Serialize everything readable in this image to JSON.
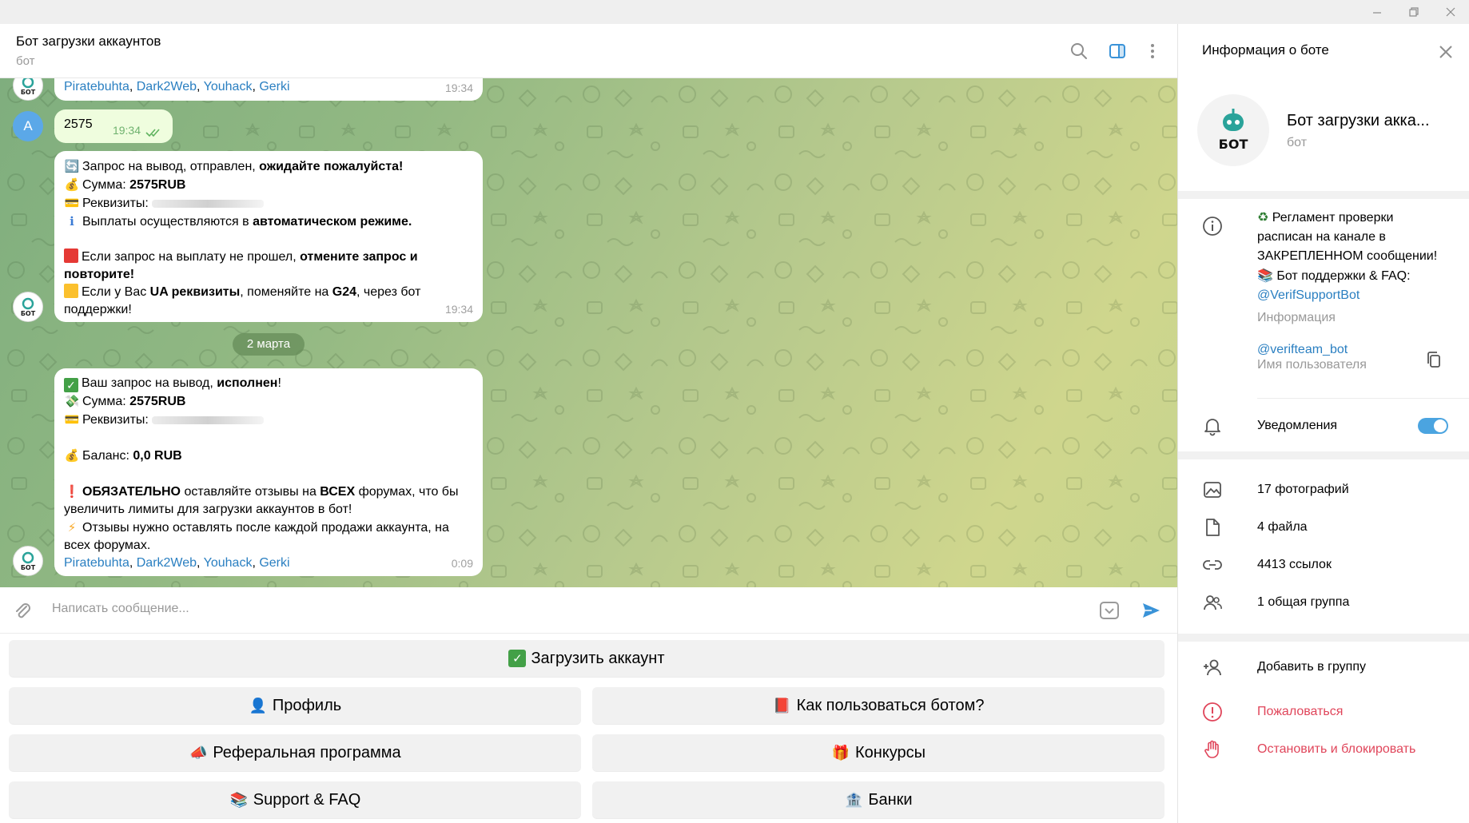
{
  "header": {
    "title": "Бот загрузки аккаунтов",
    "subtitle": "бот"
  },
  "messages": {
    "m1": {
      "links": [
        "Piratebuhta",
        "Dark2Web",
        "Youhack",
        "Gerki"
      ],
      "time": "19:34"
    },
    "m2": {
      "avatar_letter": "A",
      "text": "2575",
      "time": "19:34"
    },
    "m3": {
      "l1_pre": "Запрос на вывод,  отправлен, ",
      "l1_bold": "ожидайте пожалуйста!",
      "l2_pre": "Сумма: ",
      "l2_bold": "2575RUB",
      "l3_pre": "Реквизиты:",
      "l4_pre": "Выплаты осуществляются в ",
      "l4_bold": "автоматическом режиме.",
      "l5_pre": "Если запрос на выплату не прошел, ",
      "l5_bold": "отмените запрос и",
      "l6_bold": "повторите!",
      "l7_pre": "Если у Вас ",
      "l7_bold1": "UA реквизиты",
      "l7_mid": ", поменяйте на ",
      "l7_bold2": "G24",
      "l7_post": ", через бот",
      "l8": "поддержки!",
      "time": "19:34"
    },
    "date_divider": "2 марта",
    "m4": {
      "l1_pre": "Ваш запрос на вывод, ",
      "l1_bold": "исполнен",
      "l1_post": "!",
      "l2_pre": "Сумма: ",
      "l2_bold": "2575RUB",
      "l3_pre": "Реквизиты:",
      "l5_pre": "Баланс: ",
      "l5_bold": "0,0 RUB",
      "l6_bold1": "ОБЯЗАТЕЛЬНО",
      "l6_mid": " оставляйте отзывы на ",
      "l6_bold2": "ВСЕХ",
      "l6_post": " форумах, что бы",
      "l7": "увеличить лимиты для загрузки аккаунтов в бот!",
      "l8": "Отзывы нужно оставлять после каждой продажи аккаунта, на",
      "l9": "всех форумах.",
      "links": [
        "Piratebuhta",
        "Dark2Web",
        "Youhack",
        "Gerki"
      ],
      "time": "0:09"
    }
  },
  "input": {
    "placeholder": "Написать сообщение..."
  },
  "keyboard": {
    "upload": "Загрузить аккаунт",
    "profile": "Профиль",
    "howto": "Как пользоваться ботом?",
    "referral": "Реферальная программа",
    "contests": "Конкурсы",
    "support": "Support & FAQ",
    "banks": "Банки"
  },
  "panel": {
    "title": "Информация о боте",
    "name": "Бот загрузки акка...",
    "sub": "бот",
    "avatar_text": "БОТ",
    "info_l1": "Регламент проверки",
    "info_l2": "расписан на канале в",
    "info_l3": "ЗАКРЕПЛЕННОМ сообщении!",
    "info_l4": "Бот поддержки & FAQ:",
    "info_link": "@VerifSupportBot",
    "info_label": "Информация",
    "username": "@verifteam_bot",
    "username_label": "Имя пользователя",
    "notifications": "Уведомления",
    "photos": "17 фотографий",
    "files": "4 файла",
    "links": "4413 ссылок",
    "groups": "1 общая группа",
    "add_group": "Добавить в группу",
    "report": "Пожаловаться",
    "block": "Остановить и блокировать"
  },
  "colors": {
    "accent": "#4ba4e0",
    "link": "#2a7fc1",
    "danger": "#e0455a",
    "outgoing_bubble": "#effdde"
  }
}
